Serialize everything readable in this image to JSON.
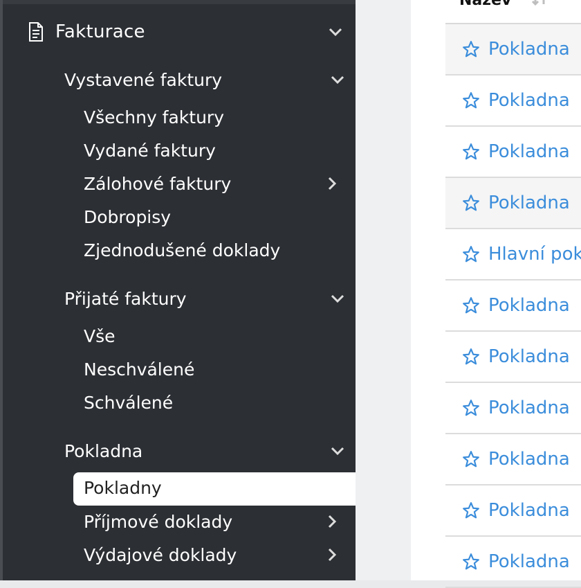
{
  "sidebar": {
    "section": {
      "label": "Fakturace",
      "icon": "document-icon",
      "expanded": true
    },
    "groups": [
      {
        "label": "Vystavené faktury",
        "expanded": true,
        "items": [
          {
            "label": "Všechny faktury"
          },
          {
            "label": "Vydané faktury"
          },
          {
            "label": "Zálohové faktury",
            "has_submenu": true
          },
          {
            "label": "Dobropisy"
          },
          {
            "label": "Zjednodušené doklady"
          }
        ]
      },
      {
        "label": "Přijaté faktury",
        "expanded": true,
        "items": [
          {
            "label": "Vše"
          },
          {
            "label": "Neschválené"
          },
          {
            "label": "Schválené"
          }
        ]
      },
      {
        "label": "Pokladna",
        "expanded": true,
        "items": [
          {
            "label": "Pokladny",
            "active": true
          },
          {
            "label": "Příjmové doklady",
            "has_submenu": true
          },
          {
            "label": "Výdajové doklady",
            "has_submenu": true
          }
        ]
      }
    ]
  },
  "table": {
    "column_header": "Název",
    "rows": [
      {
        "name": "Pokladna"
      },
      {
        "name": "Pokladna"
      },
      {
        "name": "Pokladna"
      },
      {
        "name": "Pokladna"
      },
      {
        "name": "Hlavní pok"
      },
      {
        "name": "Pokladna"
      },
      {
        "name": "Pokladna"
      },
      {
        "name": "Pokladna"
      },
      {
        "name": "Pokladna"
      },
      {
        "name": "Pokladna"
      },
      {
        "name": "Pokladna"
      }
    ]
  },
  "colors": {
    "sidebar_bg": "#2c2f34",
    "link": "#3b8ddb",
    "active_bg": "#ffffff"
  }
}
